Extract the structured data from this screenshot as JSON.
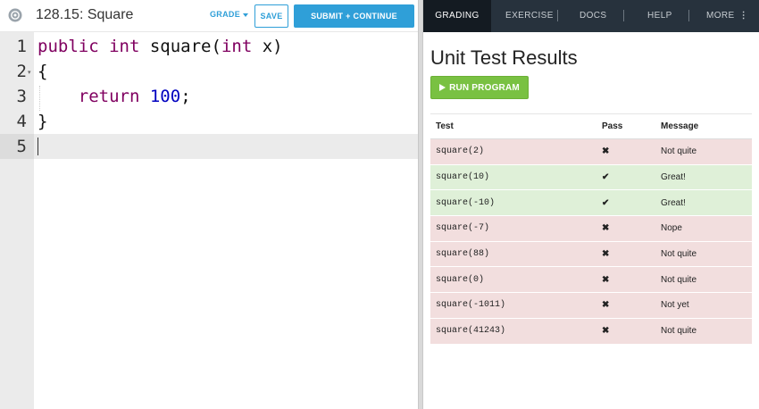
{
  "header": {
    "title": "128.15: Square",
    "grade_label": "GRADE",
    "save_label": "SAVE",
    "submit_label": "SUBMIT + CONTINUE"
  },
  "editor": {
    "line_numbers": [
      "1",
      "2",
      "3",
      "4",
      "5"
    ],
    "lines": [
      [
        {
          "t": "public",
          "c": "kw"
        },
        {
          "t": " "
        },
        {
          "t": "int",
          "c": "kw"
        },
        {
          "t": " square("
        },
        {
          "t": "int",
          "c": "kw"
        },
        {
          "t": " x)"
        }
      ],
      [
        {
          "t": "{"
        }
      ],
      [
        {
          "t": "    "
        },
        {
          "t": "return",
          "c": "kw"
        },
        {
          "t": " "
        },
        {
          "t": "100",
          "c": "num"
        },
        {
          "t": ";"
        }
      ],
      [
        {
          "t": "}"
        }
      ],
      []
    ]
  },
  "nav": {
    "tabs": [
      {
        "id": "grading",
        "label": "GRADING"
      },
      {
        "id": "exercise",
        "label": "EXERCISE"
      },
      {
        "id": "docs",
        "label": "DOCS"
      },
      {
        "id": "help",
        "label": "HELP"
      },
      {
        "id": "more",
        "label": "MORE"
      }
    ],
    "more_glyph": "⋮"
  },
  "results": {
    "title": "Unit Test Results",
    "run_label": "RUN PROGRAM",
    "columns": {
      "test": "Test",
      "pass": "Pass",
      "message": "Message"
    },
    "rows": [
      {
        "test": "square(2)",
        "pass": false,
        "mark": "✖",
        "message": "Not quite"
      },
      {
        "test": "square(10)",
        "pass": true,
        "mark": "✔",
        "message": "Great!"
      },
      {
        "test": "square(-10)",
        "pass": true,
        "mark": "✔",
        "message": "Great!"
      },
      {
        "test": "square(-7)",
        "pass": false,
        "mark": "✖",
        "message": "Nope"
      },
      {
        "test": "square(88)",
        "pass": false,
        "mark": "✖",
        "message": "Not quite"
      },
      {
        "test": "square(0)",
        "pass": false,
        "mark": "✖",
        "message": "Not quite"
      },
      {
        "test": "square(-1011)",
        "pass": false,
        "mark": "✖",
        "message": "Not yet"
      },
      {
        "test": "square(41243)",
        "pass": false,
        "mark": "✖",
        "message": "Not quite"
      }
    ]
  },
  "colors": {
    "accent": "#2f9fd8",
    "run_button": "#79c142",
    "nav_bg": "#27323d",
    "pass_row": "#dff0d8",
    "fail_row": "#f2dede",
    "keyword": "#800060",
    "number": "#0000c0"
  }
}
